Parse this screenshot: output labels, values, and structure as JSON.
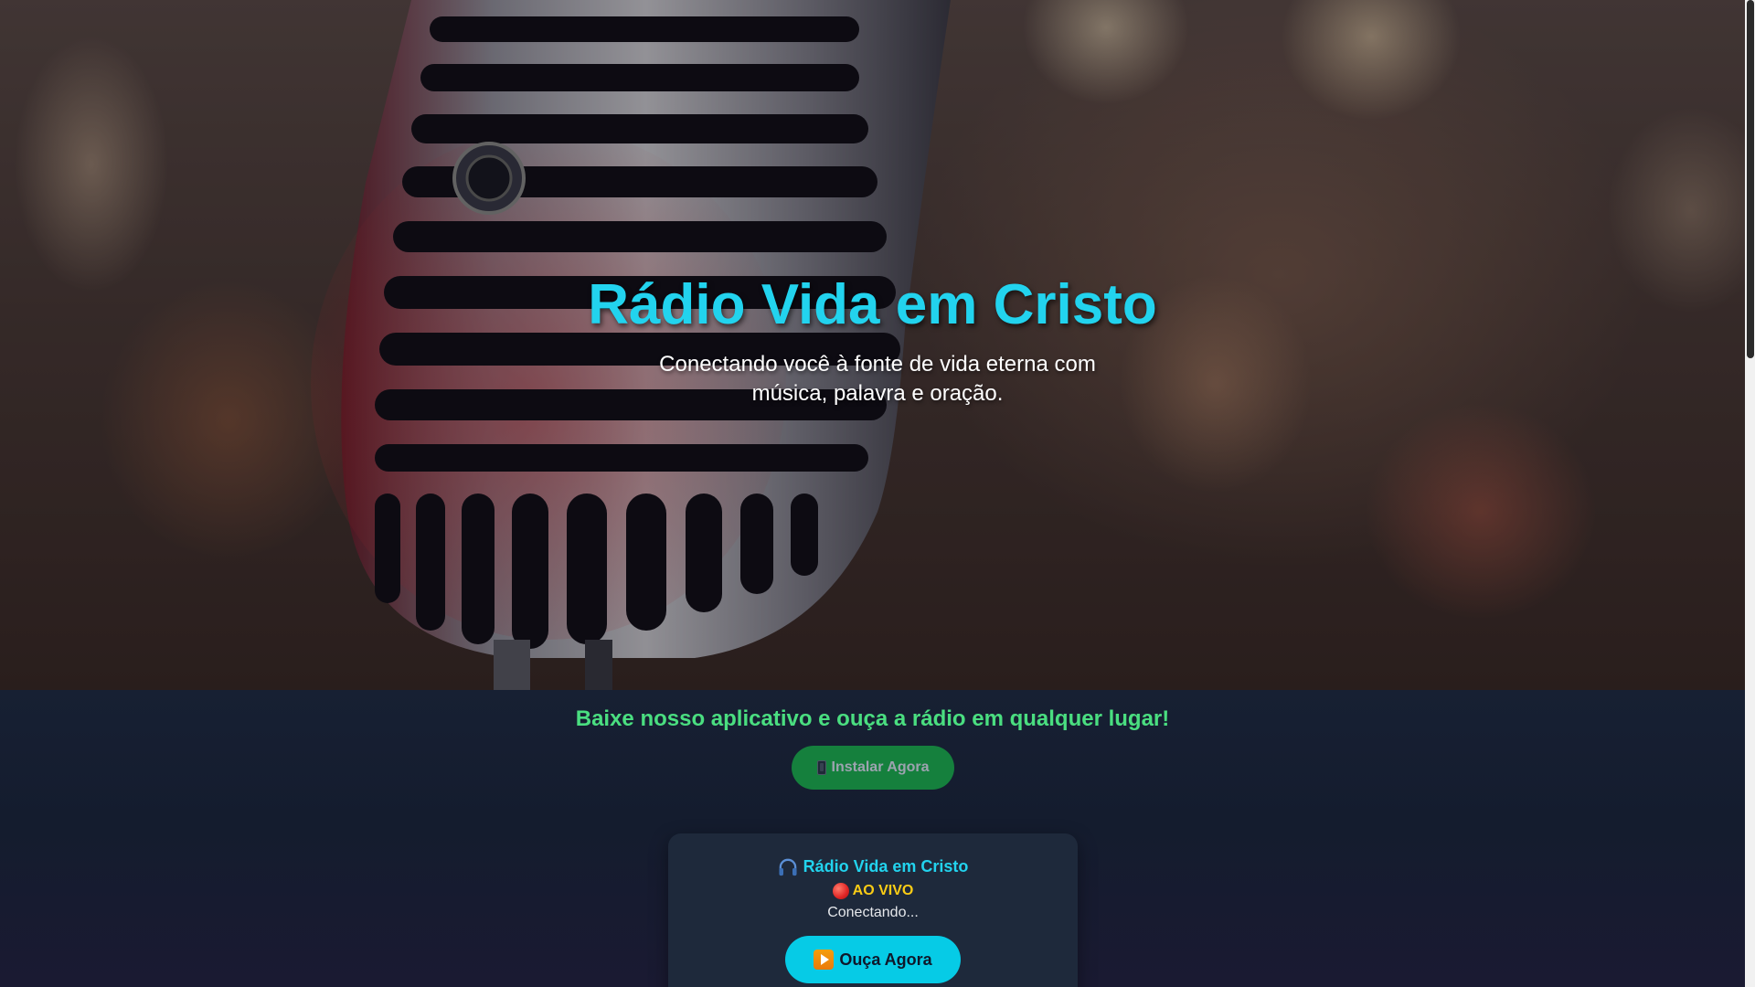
{
  "hero": {
    "title": "Rádio Vida em Cristo",
    "subtitle": "Conectando você à fonte de vida eterna com música, palavra e oração.",
    "background_image": "microphone-icon"
  },
  "app_banner": {
    "title": "Baixe nosso aplicativo e ouça a rádio em qualquer lugar!",
    "install_button": {
      "icon": "phone-icon",
      "label": "Instalar Agora"
    }
  },
  "player": {
    "station_icon": "headphones-icon",
    "station_name": "Rádio Vida em Cristo",
    "live_icon": "red-dot-icon",
    "live_label": "AO VIVO",
    "status_text": "Conectando...",
    "listen_button": {
      "icon": "play-icon",
      "label": "Ouça Agora"
    }
  },
  "colors": {
    "accent_cyan": "#22d3ee",
    "accent_green": "#4ade80",
    "install_button_bg": "#15803d",
    "live_yellow": "#facc15",
    "card_bg": "#1e293b",
    "page_bg": "#141a2b"
  }
}
